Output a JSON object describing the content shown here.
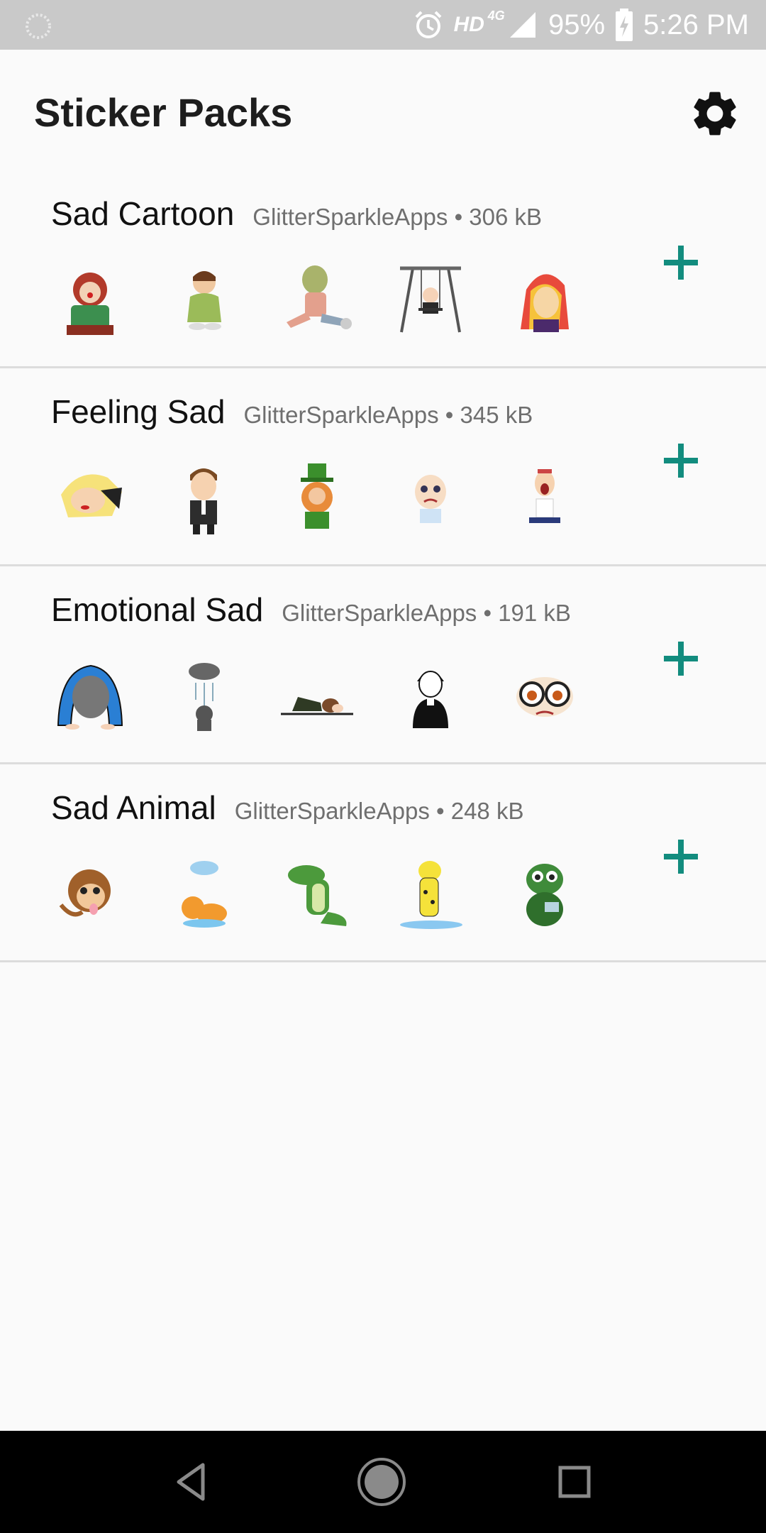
{
  "status_bar": {
    "network": "HD",
    "network_type": "4G",
    "battery": "95%",
    "time": "5:26 PM"
  },
  "app_bar": {
    "title": "Sticker Packs",
    "settings_icon": "gear-icon"
  },
  "packs": [
    {
      "name": "Sad Cartoon",
      "meta": "GlitterSparkleApps • 306 kB",
      "stickers": [
        "sad-clown-sticker",
        "sad-boy-sticker",
        "sad-zombie-sticker",
        "sad-swing-sticker",
        "sad-pony-girl-sticker"
      ]
    },
    {
      "name": "Feeling Sad",
      "meta": "GlitterSparkleApps • 345 kB",
      "stickers": [
        "crying-woman-sticker",
        "sad-man-sticker",
        "sad-leprechaun-sticker",
        "crying-kid-sticker",
        "sad-cartoon-sticker"
      ]
    },
    {
      "name": "Emotional Sad",
      "meta": "GlitterSparkleApps • 191 kB",
      "stickers": [
        "bowing-person-sticker",
        "rain-cloud-sticker",
        "lying-down-sticker",
        "sad-person-sticker",
        "crying-glasses-sticker"
      ]
    },
    {
      "name": "Sad Animal",
      "meta": "GlitterSparkleApps • 248 kB",
      "stickers": [
        "sad-monkey-sticker",
        "sad-cat-sticker",
        "sad-crocodile-sticker",
        "wet-dog-sticker",
        "sad-turtle-sticker"
      ]
    }
  ],
  "colors": {
    "accent": "#128c7e",
    "status_bar": "#c9c9c9",
    "background": "#fafafa"
  }
}
